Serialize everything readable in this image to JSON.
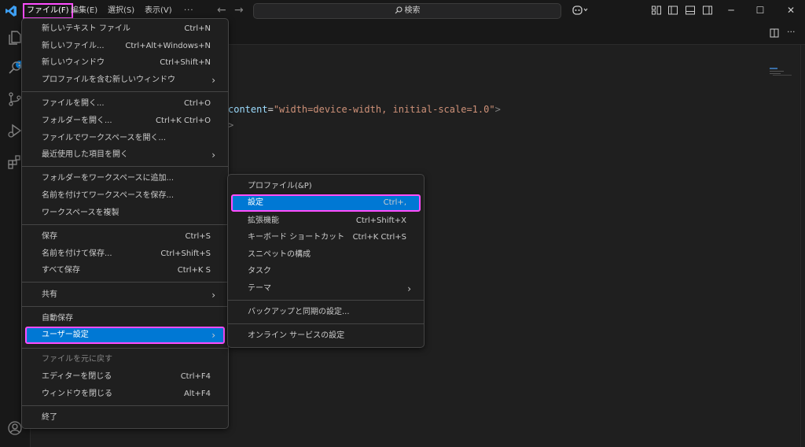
{
  "titlebar": {
    "menus": [
      "ファイル(F)",
      "編集(E)",
      "選択(S)",
      "表示(V)",
      "···"
    ],
    "search_placeholder": "検索"
  },
  "activitybar": {
    "badge_count": "1"
  },
  "editor": {
    "code": {
      "attr": "content",
      "eq": "=",
      "str": "\"width=device-width, initial-scale=1.0\"",
      "close": ">",
      "line2": ">"
    }
  },
  "file_menu": {
    "items": [
      {
        "label": "新しいテキスト ファイル",
        "shortcut": "Ctrl+N"
      },
      {
        "label": "新しいファイル...",
        "shortcut": "Ctrl+Alt+Windows+N"
      },
      {
        "label": "新しいウィンドウ",
        "shortcut": "Ctrl+Shift+N"
      },
      {
        "label": "プロファイルを含む新しいウィンドウ",
        "shortcut": ""
      },
      {
        "label": "ファイルを開く...",
        "shortcut": "Ctrl+O"
      },
      {
        "label": "フォルダーを開く...",
        "shortcut": "Ctrl+K Ctrl+O"
      },
      {
        "label": "ファイルでワークスペースを開く...",
        "shortcut": ""
      },
      {
        "label": "最近使用した項目を開く",
        "shortcut": ""
      },
      {
        "label": "フォルダーをワークスペースに追加...",
        "shortcut": ""
      },
      {
        "label": "名前を付けてワークスペースを保存...",
        "shortcut": ""
      },
      {
        "label": "ワークスペースを複製",
        "shortcut": ""
      },
      {
        "label": "保存",
        "shortcut": "Ctrl+S"
      },
      {
        "label": "名前を付けて保存...",
        "shortcut": "Ctrl+Shift+S"
      },
      {
        "label": "すべて保存",
        "shortcut": "Ctrl+K S"
      },
      {
        "label": "共有",
        "shortcut": ""
      },
      {
        "label": "自動保存",
        "shortcut": ""
      },
      {
        "label": "ユーザー設定",
        "shortcut": ""
      },
      {
        "label": "ファイルを元に戻す",
        "shortcut": ""
      },
      {
        "label": "エディターを閉じる",
        "shortcut": "Ctrl+F4"
      },
      {
        "label": "ウィンドウを閉じる",
        "shortcut": "Alt+F4"
      },
      {
        "label": "終了",
        "shortcut": ""
      }
    ]
  },
  "prefs_menu": {
    "items": [
      {
        "label": "プロファイル(&P)",
        "shortcut": ""
      },
      {
        "label": "設定",
        "shortcut": "Ctrl+,"
      },
      {
        "label": "拡張機能",
        "shortcut": "Ctrl+Shift+X"
      },
      {
        "label": "キーボード ショートカット",
        "shortcut": "Ctrl+K Ctrl+S"
      },
      {
        "label": "スニペットの構成",
        "shortcut": ""
      },
      {
        "label": "タスク",
        "shortcut": ""
      },
      {
        "label": "テーマ",
        "shortcut": ""
      },
      {
        "label": "バックアップと同期の設定...",
        "shortcut": ""
      },
      {
        "label": "オンライン サービスの設定",
        "shortcut": ""
      }
    ]
  },
  "colors": {
    "accent": "#0078d4",
    "highlight_outline": "#ff4dff"
  }
}
